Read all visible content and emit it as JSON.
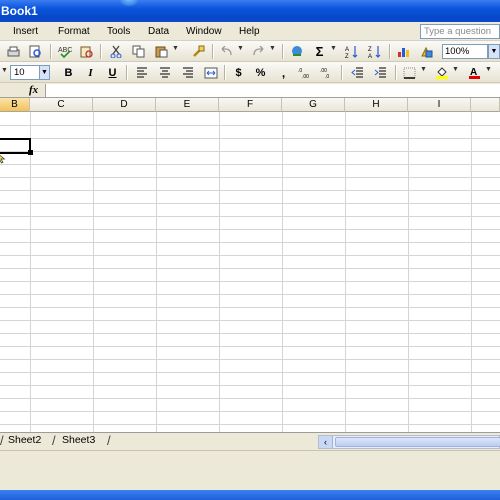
{
  "window": {
    "title": "Book1"
  },
  "menu": {
    "items": [
      {
        "label": "Insert",
        "ul": "I"
      },
      {
        "label": "Format",
        "ul": "o"
      },
      {
        "label": "Tools",
        "ul": "T"
      },
      {
        "label": "Data",
        "ul": "D"
      },
      {
        "label": "Window",
        "ul": "W"
      },
      {
        "label": "Help",
        "ul": "H"
      }
    ],
    "help_placeholder": "Type a question"
  },
  "toolbar": {
    "zoom": "100%",
    "font_size": "10",
    "bold": "B",
    "italic": "I",
    "underline": "U",
    "currency": "$",
    "percent": "%",
    "comma": ",",
    "autosum": "Σ"
  },
  "formula_bar": {
    "fx_label": "fx",
    "content": ""
  },
  "grid": {
    "columns": [
      "B",
      "C",
      "D",
      "E",
      "F",
      "G",
      "H",
      "I"
    ]
  },
  "sheets": {
    "tabs": [
      "Sheet2",
      "Sheet3"
    ]
  },
  "colors": {
    "title_bar": "#0a55dc",
    "chrome": "#ece9d8",
    "gridline": "#d4d4d4",
    "font_color_red": "#e00000",
    "fill_yellow": "#ffff00"
  }
}
